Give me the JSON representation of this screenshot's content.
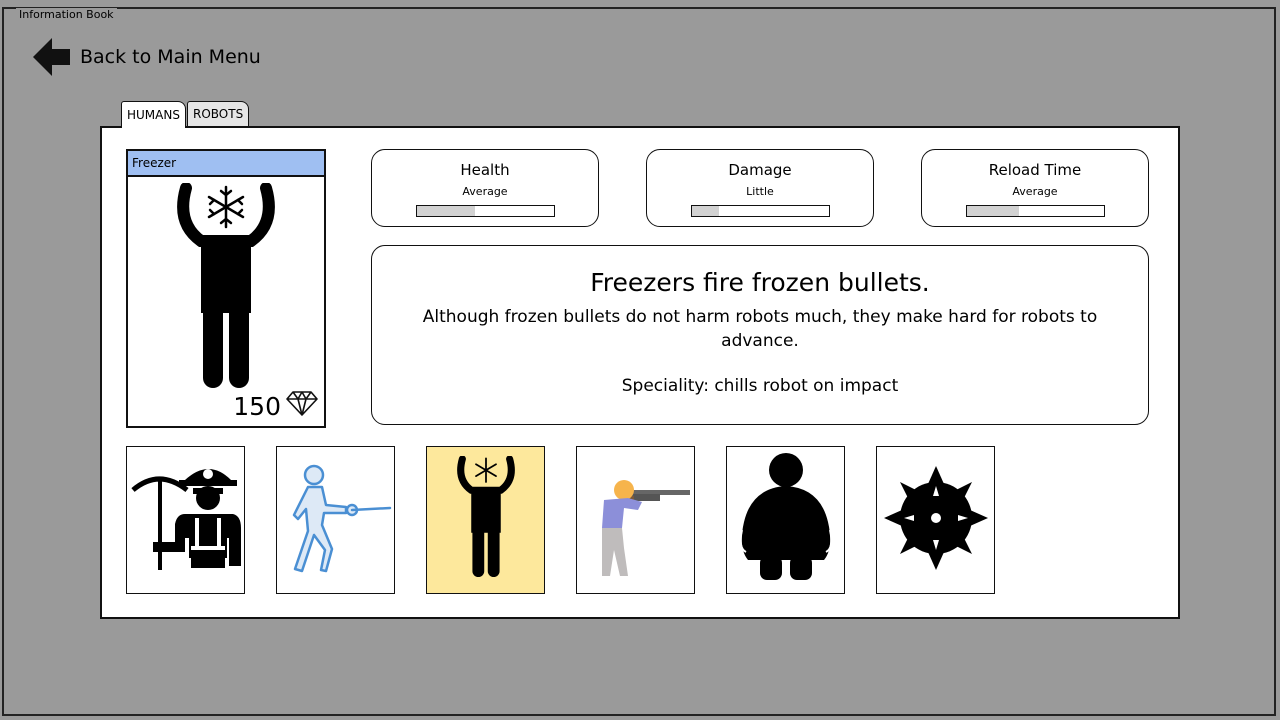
{
  "window": {
    "title": "Information Book"
  },
  "nav": {
    "back_label": "Back to Main Menu"
  },
  "tabs": [
    {
      "label": "HUMANS",
      "active": true
    },
    {
      "label": "ROBOTS",
      "active": false
    }
  ],
  "selected_unit": {
    "name": "Freezer",
    "cost": "150",
    "icon": "freezer-icon",
    "header_color": "#9fbff2"
  },
  "stats": [
    {
      "name": "Health",
      "level": "Average",
      "fill": 0.42
    },
    {
      "name": "Damage",
      "level": "Little",
      "fill": 0.2
    },
    {
      "name": "Reload Time",
      "level": "Average",
      "fill": 0.38
    }
  ],
  "description": {
    "title": "Freezers fire frozen bullets.",
    "body": "Although frozen bullets do not harm robots much, they make hard for robots to advance.",
    "speciality": "Speciality: chills robot on impact"
  },
  "units": [
    {
      "icon": "miner-icon",
      "selected": false
    },
    {
      "icon": "fencer-icon",
      "selected": false
    },
    {
      "icon": "freezer-icon",
      "selected": true
    },
    {
      "icon": "rifleman-icon",
      "selected": false
    },
    {
      "icon": "heavy-man-icon",
      "selected": false
    },
    {
      "icon": "spiked-mine-icon",
      "selected": false
    }
  ],
  "colors": {
    "background": "#9a9a9a",
    "selected_thumb": "#fde89c",
    "bar_fill": "#d2d2d2"
  }
}
